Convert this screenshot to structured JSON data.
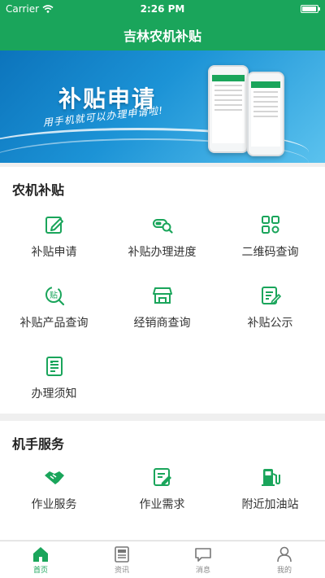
{
  "status_bar": {
    "carrier": "Carrier",
    "time": "2:26 PM",
    "battery_level": 0.92
  },
  "header": {
    "title": "吉林农机补贴"
  },
  "banner": {
    "title": "补贴申请",
    "subtitle": "用手机就可以办理申请啦!"
  },
  "sections": [
    {
      "title": "农机补贴",
      "items": [
        {
          "label": "补贴申请",
          "icon": "edit-icon"
        },
        {
          "label": "补贴办理进度",
          "icon": "progress-search-icon"
        },
        {
          "label": "二维码查询",
          "icon": "qr-code-icon"
        },
        {
          "label": "补贴产品查询",
          "icon": "subsidy-search-icon"
        },
        {
          "label": "经销商查询",
          "icon": "store-icon"
        },
        {
          "label": "补贴公示",
          "icon": "announcement-icon"
        },
        {
          "label": "办理须知",
          "icon": "notice-icon"
        }
      ]
    },
    {
      "title": "机手服务",
      "items": [
        {
          "label": "作业服务",
          "icon": "handshake-icon"
        },
        {
          "label": "作业需求",
          "icon": "demand-icon"
        },
        {
          "label": "附近加油站",
          "icon": "gas-station-icon"
        }
      ]
    }
  ],
  "tabbar": {
    "tabs": [
      {
        "label": "首页",
        "icon": "home-icon",
        "active": true
      },
      {
        "label": "资讯",
        "icon": "news-icon",
        "active": false
      },
      {
        "label": "消息",
        "icon": "message-icon",
        "active": false
      },
      {
        "label": "我的",
        "icon": "profile-icon",
        "active": false
      }
    ]
  },
  "colors": {
    "primary": "#1aa55b",
    "banner": "#1c93d6",
    "text": "#333333",
    "inactive": "#888888"
  }
}
